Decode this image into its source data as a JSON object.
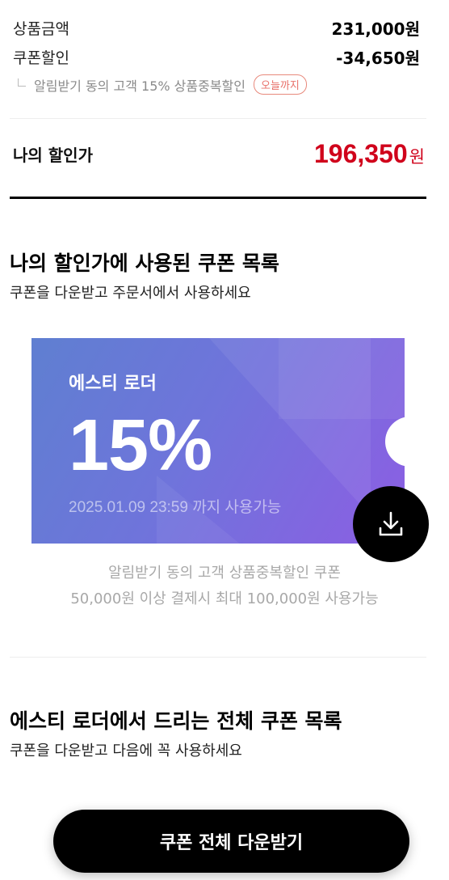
{
  "summary": {
    "product_price_label": "상품금액",
    "product_price_value": "231,000원",
    "coupon_discount_label": "쿠폰할인",
    "coupon_discount_value": "-34,650원",
    "sub_discount_text": "알림받기 동의 고객 15% 상품중복할인",
    "sub_discount_badge": "오늘까지"
  },
  "my_price": {
    "label": "나의 할인가",
    "amount": "196,350",
    "unit": "원",
    "color": "#d0021b"
  },
  "used_coupons": {
    "title": "나의 할인가에 사용된 쿠폰 목록",
    "subtitle": "쿠폰을 다운받고 주문서에서 사용하세요"
  },
  "coupon": {
    "brand": "에스티 로더",
    "percent": "15%",
    "valid_until": "2025.01.09 23:59 까지 사용가능",
    "desc_line1": "알림받기 동의 고객 상품중복할인 쿠폰",
    "desc_line2": "50,000원 이상 결제시 최대 100,000원 사용가능",
    "download_icon": "download-icon",
    "gradient_start": "#5f7fd1",
    "gradient_end": "#8c5ee3"
  },
  "all_coupons": {
    "title": "에스티 로더에서 드리는 전체 쿠폰 목록",
    "subtitle": "쿠폰을 다운받고 다음에 꼭 사용하세요"
  },
  "cta": {
    "label": "쿠폰 전체 다운받기"
  }
}
